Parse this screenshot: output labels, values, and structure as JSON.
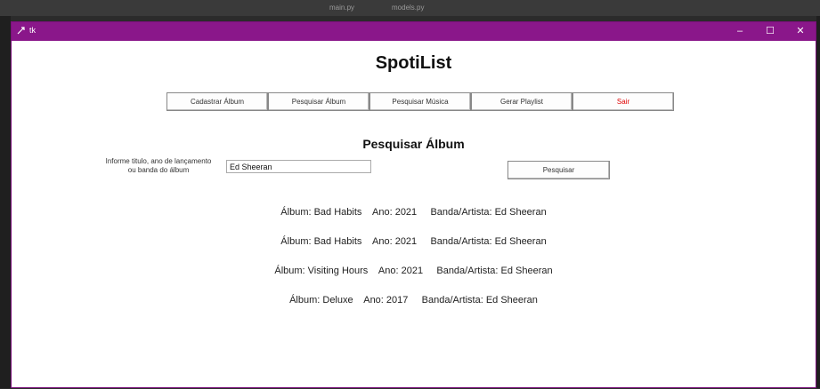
{
  "desktop": {
    "tab1": "main.py",
    "tab2": "models.py"
  },
  "window": {
    "title": "tk",
    "controls": {
      "minimize": "–",
      "maximize": "☐",
      "close": "✕"
    }
  },
  "app": {
    "title": "SpotiList",
    "toolbar": [
      {
        "label": "Cadastrar Álbum"
      },
      {
        "label": "Pesquisar Álbum"
      },
      {
        "label": "Pesquisar Música"
      },
      {
        "label": "Gerar Playlist"
      },
      {
        "label": "Sair"
      }
    ],
    "section_title": "Pesquisar Álbum",
    "search": {
      "label_line1": "Informe titulo, ano de lançamento",
      "label_line2": "ou banda do álbum",
      "value": "Ed Sheeran",
      "button_label": "Pesquisar"
    },
    "results": [
      {
        "text": "Álbum: Bad Habits    Ano: 2021     Banda/Artista: Ed Sheeran"
      },
      {
        "text": "Álbum: Bad Habits    Ano: 2021     Banda/Artista: Ed Sheeran"
      },
      {
        "text": "Álbum: Visiting Hours    Ano: 2021     Banda/Artista: Ed Sheeran"
      },
      {
        "text": "Álbum: Deluxe    Ano: 2017     Banda/Artista: Ed Sheeran"
      }
    ]
  }
}
